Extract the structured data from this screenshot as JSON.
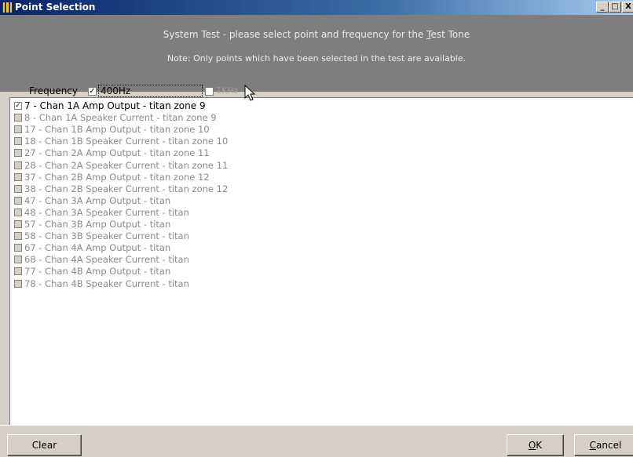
{
  "window": {
    "title": "Point Selection",
    "min_glyph": "_",
    "max_glyph": "□",
    "close_glyph": "X"
  },
  "header": {
    "line1_prefix": "System Test -  please select point and frequency for the ",
    "line1_underlined": "T",
    "line1_suffix": "est Tone",
    "line2": "Note:  Only points which have been selected in the test are available."
  },
  "frequency": {
    "label": "Frequency",
    "option_400": {
      "label": "400Hz",
      "checked": true
    },
    "option_1k": {
      "label": "1KHz",
      "checked": false,
      "enabled": false
    }
  },
  "points": [
    {
      "label": "7 - Chan 1A Amp Output - titan zone 9",
      "checked": true,
      "enabled": true
    },
    {
      "label": "8 - Chan 1A Speaker Current - titan zone 9",
      "checked": false,
      "enabled": false
    },
    {
      "label": "17 - Chan 1B Amp Output - titan zone 10",
      "checked": false,
      "enabled": false
    },
    {
      "label": "18 - Chan 1B Speaker Current - titan zone 10",
      "checked": false,
      "enabled": false
    },
    {
      "label": "27 - Chan 2A Amp Output - titan zone 11",
      "checked": false,
      "enabled": false
    },
    {
      "label": "28 - Chan 2A Speaker Current - titan zone 11",
      "checked": false,
      "enabled": false
    },
    {
      "label": "37 - Chan 2B Amp Output - titan zone 12",
      "checked": false,
      "enabled": false
    },
    {
      "label": "38 - Chan 2B Speaker Current - titan zone 12",
      "checked": false,
      "enabled": false
    },
    {
      "label": "47 - Chan 3A Amp Output - titan",
      "checked": false,
      "enabled": false
    },
    {
      "label": "48 - Chan 3A Speaker Current - titan",
      "checked": false,
      "enabled": false
    },
    {
      "label": "57 - Chan 3B Amp Output - titan",
      "checked": false,
      "enabled": false
    },
    {
      "label": "58 - Chan 3B Speaker Current - titan",
      "checked": false,
      "enabled": false
    },
    {
      "label": "67 - Chan 4A Amp Output - titan",
      "checked": false,
      "enabled": false
    },
    {
      "label": "68 - Chan 4A Speaker Current - titan",
      "checked": false,
      "enabled": false
    },
    {
      "label": "77 - Chan 4B Amp Output - titan",
      "checked": false,
      "enabled": false
    },
    {
      "label": "78 - Chan 4B Speaker Current - titan",
      "checked": false,
      "enabled": false
    }
  ],
  "buttons": {
    "clear": "Clear",
    "ok_underlined": "O",
    "ok_rest": "K",
    "cancel_underlined": "C",
    "cancel_rest": "ancel"
  },
  "colors": {
    "header_bg": "#7e7e7e",
    "titlebar_start": "#0a246a",
    "dialog_bg": "#d4d0c8"
  }
}
